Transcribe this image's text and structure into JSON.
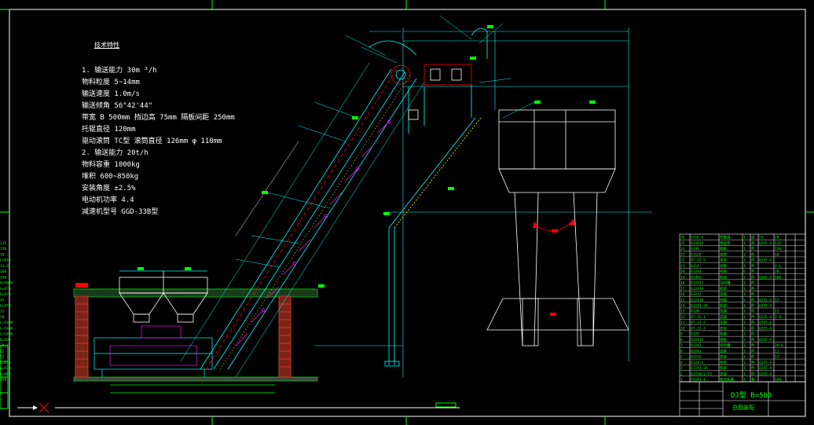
{
  "spec": {
    "title": "技术特性",
    "lines": [
      "1.  输送能力 30m  ³/h",
      "    物料粒度 5~14mm",
      "    输送速度 1.0m/s",
      "    输送倾角 56°42'44\"",
      "    带宽 B 500mm  挡边高 75mm  隔板间距 250mm",
      "    托辊直径 120mm",
      "    驱动滚筒 TC型  滚筒直径 126mm  φ 110mm",
      "2.  输送能力 20t/h",
      "    物料容重 1000kg",
      "         堆积 600~850kg",
      "    安装角度   ±2.5%",
      "    电动机功率 4.4",
      "    减速机型号 GGD-33B型"
    ]
  },
  "title_block": {
    "model": "DJ型 B=500",
    "subtitle": "总图装配"
  },
  "bom_rows": [
    [
      "26",
      "DJ1E-A",
      "托辊组",
      "1",
      "组",
      "55",
      "28"
    ],
    [
      "25",
      "DJ2B1A",
      "挡边带",
      "1",
      "条",
      "Q235-A",
      "115",
      "115"
    ],
    [
      "24",
      "DJ3B",
      "隔板",
      "1",
      "件",
      "",
      "150",
      "150"
    ],
    [
      "23",
      "DJ1ED",
      "滚筒",
      "1",
      "件",
      "",
      "10",
      "10"
    ],
    [
      "22",
      "DT-J2-5",
      "支架",
      "1",
      "件",
      "Q235-A",
      "",
      "L=810"
    ],
    [
      "21",
      "DJ1A",
      "托辊",
      "1",
      "件",
      "",
      "2.1",
      "13.8"
    ],
    [
      "20",
      "DJ2A1",
      "托辊",
      "8",
      "件",
      "",
      "28",
      "108"
    ],
    [
      "19",
      "DJ3B2",
      "机架",
      "1",
      "件",
      "Q235-A",
      "560",
      "150"
    ],
    [
      "18",
      "DJ2A1J",
      "导料槽",
      "1",
      "件",
      "",
      "",
      "H=5000"
    ],
    [
      "17",
      "DJ2A1A",
      "机架",
      "1",
      "件",
      "",
      "",
      "H=870"
    ],
    [
      "16",
      "DJ2A2",
      "支腿",
      "1",
      "件",
      "",
      "",
      "H=870"
    ],
    [
      "15",
      "DJ2A1B",
      "托辊",
      "5",
      "件",
      "Q235-A",
      "17",
      "45"
    ],
    [
      "14",
      "DJ2A1-3A",
      "机架",
      "1",
      "件",
      "Q235-A",
      "",
      "H=870"
    ],
    [
      "13",
      "DJ2B",
      "支腿",
      "1",
      "件",
      "",
      "12",
      "32"
    ],
    [
      "12",
      "DT-J2-1",
      "支腿",
      "1",
      "件",
      "Q235-A",
      "2.8",
      "20"
    ],
    [
      "11",
      "DT-J2-2",
      "支腿",
      "1",
      "件",
      "Q235-A",
      "",
      "L=5400"
    ],
    [
      "10",
      "DT-J2-3",
      "支架",
      "1",
      "件",
      "Q235-A",
      "",
      "L=5400"
    ],
    [
      "9",
      "DJ2E",
      "机尾",
      "1",
      "件",
      "",
      "",
      "L=5400"
    ],
    [
      "8",
      "DJ2A1E",
      "挡板",
      "2",
      "件",
      "Q235-A",
      "",
      "D=500"
    ],
    [
      "7",
      "DJ2A2",
      "导料槽",
      "1",
      "件",
      "",
      "28.6",
      "28.6"
    ],
    [
      "6",
      "DJ2A1",
      "拉紧",
      "1",
      "件",
      "",
      "11",
      "22"
    ],
    [
      "5",
      "DJ2J2",
      "支架",
      "1",
      "件",
      "",
      "51",
      "52"
    ],
    [
      "4",
      "DJ2A-3",
      "机架",
      "1",
      "件",
      "Q235-A",
      "",
      "L=870"
    ],
    [
      "3",
      "DJ2A1-3A",
      "机架",
      "1",
      "件",
      "Q235-A",
      "",
      "L=870"
    ],
    [
      "2",
      "DJ2A0/2-53",
      "支架",
      "1",
      "件",
      "Q235-A",
      "",
      "L=600"
    ],
    [
      "1",
      "DJ2A1-1",
      "驱动装置",
      "1",
      "套",
      "",
      "108",
      "258"
    ]
  ],
  "colors": {
    "cyan": "#00ffff",
    "green": "#00ff00",
    "yellow": "#ffff00",
    "red": "#ff0000",
    "white": "#ffffff",
    "magenta": "#ff00ff",
    "brick": "#c83c28"
  }
}
